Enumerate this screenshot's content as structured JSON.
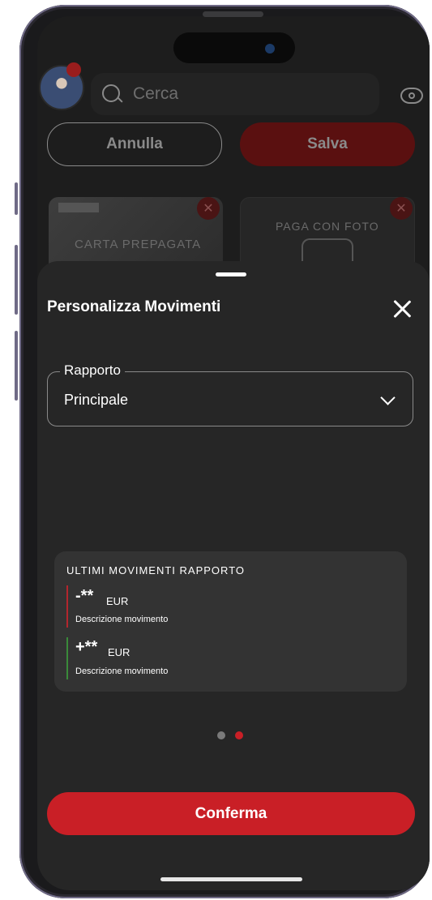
{
  "background_app": {
    "search": {
      "placeholder": "Cerca",
      "icon": "search-icon"
    },
    "visibility_icon": "eye-icon",
    "buttons": {
      "cancel_label": "Annulla",
      "save_label": "Salva"
    },
    "cards": [
      {
        "label": "CARTA PREPAGATA"
      },
      {
        "label": "PAGA CON FOTO"
      }
    ]
  },
  "sheet": {
    "title": "Personalizza Movimenti",
    "close_icon": "close-icon",
    "select": {
      "label": "Rapporto",
      "value": "Principale"
    },
    "preview": {
      "title": "ULTIMI MOVIMENTI RAPPORTO",
      "movements": [
        {
          "amount": "-**",
          "currency": "EUR",
          "description": "Descrizione movimento",
          "color": "#b3262d"
        },
        {
          "amount": "+**",
          "currency": "EUR",
          "description": "Descrizione movimento",
          "color": "#3a8a3a"
        }
      ]
    },
    "pagination": {
      "total": 2,
      "active": 2
    },
    "confirm_label": "Conferma"
  },
  "colors": {
    "accent": "#c91f26",
    "sheet_bg": "#262626",
    "screen_bg": "#1d1d1d"
  }
}
